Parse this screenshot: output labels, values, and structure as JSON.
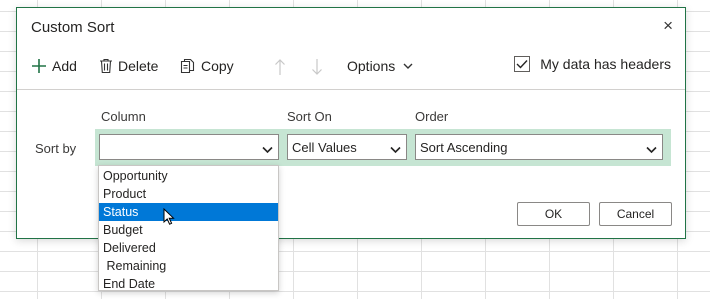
{
  "dialog": {
    "title": "Custom Sort",
    "close_glyph": "×"
  },
  "toolbar": {
    "add_label": "Add",
    "delete_label": "Delete",
    "copy_label": "Copy",
    "options_label": "Options",
    "headers_label": "My data has headers",
    "headers_checked": true
  },
  "columns": {
    "column": "Column",
    "sort_on": "Sort On",
    "order": "Order"
  },
  "row": {
    "label": "Sort by",
    "column_value": "",
    "sort_on_value": "Cell Values",
    "order_value": "Sort Ascending"
  },
  "buttons": {
    "ok": "OK",
    "cancel": "Cancel"
  },
  "dropdown": {
    "items": [
      "Opportunity",
      "Product",
      "Status",
      "Budget",
      "Delivered",
      " Remaining",
      "End Date"
    ],
    "selected_index": 2
  },
  "colors": {
    "accent_green": "#217346",
    "row_highlight": "#c6e5d3",
    "selection_blue": "#0078d7"
  }
}
